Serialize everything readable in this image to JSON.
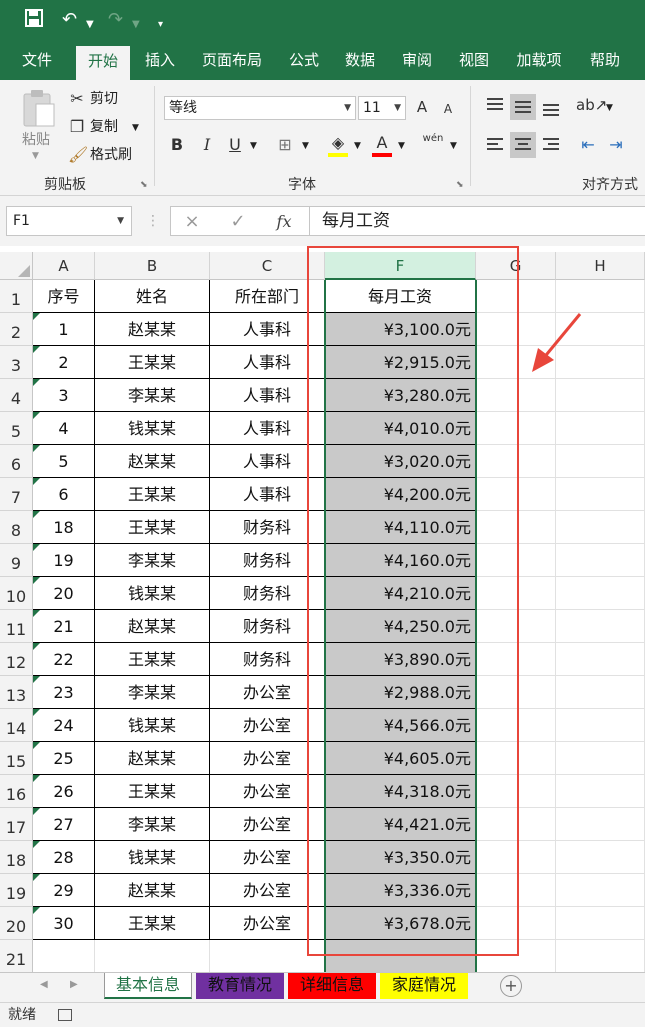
{
  "qat": {
    "save_icon": "save-icon",
    "undo_icon": "undo-icon",
    "redo_icon": "redo-icon",
    "customize_icon": "customize-qat-icon"
  },
  "tabs": [
    "文件",
    "开始",
    "插入",
    "页面布局",
    "公式",
    "数据",
    "审阅",
    "视图",
    "加载项",
    "帮助"
  ],
  "ribbon": {
    "clipboard": {
      "paste": "粘贴",
      "cut": "剪切",
      "copy": "复制",
      "format_painter": "格式刷",
      "label": "剪贴板"
    },
    "font": {
      "name": "等线",
      "size": "11",
      "bold": "B",
      "italic": "I",
      "underline": "U",
      "label": "字体",
      "grow": "A",
      "shrink": "A",
      "font_color": "A",
      "phonetic": "wén"
    },
    "alignment": {
      "label": "对齐方式"
    }
  },
  "formula_bar": {
    "name_box": "F1",
    "cancel": "×",
    "enter": "✓",
    "fx": "fx",
    "content": "每月工资"
  },
  "columns": [
    "A",
    "B",
    "C",
    "F",
    "G",
    "H"
  ],
  "rows": [
    {
      "n": "1",
      "a": "序号",
      "b": "姓名",
      "c": "所在部门",
      "f": "每月工资"
    },
    {
      "n": "2",
      "a": "1",
      "b": "赵某某",
      "c": "人事科",
      "f": "¥3,100.0元"
    },
    {
      "n": "3",
      "a": "2",
      "b": "王某某",
      "c": "人事科",
      "f": "¥2,915.0元"
    },
    {
      "n": "4",
      "a": "3",
      "b": "李某某",
      "c": "人事科",
      "f": "¥3,280.0元"
    },
    {
      "n": "5",
      "a": "4",
      "b": "钱某某",
      "c": "人事科",
      "f": "¥4,010.0元"
    },
    {
      "n": "6",
      "a": "5",
      "b": "赵某某",
      "c": "人事科",
      "f": "¥3,020.0元"
    },
    {
      "n": "7",
      "a": "6",
      "b": "王某某",
      "c": "人事科",
      "f": "¥4,200.0元"
    },
    {
      "n": "8",
      "a": "18",
      "b": "王某某",
      "c": "财务科",
      "f": "¥4,110.0元"
    },
    {
      "n": "9",
      "a": "19",
      "b": "李某某",
      "c": "财务科",
      "f": "¥4,160.0元"
    },
    {
      "n": "10",
      "a": "20",
      "b": "钱某某",
      "c": "财务科",
      "f": "¥4,210.0元"
    },
    {
      "n": "11",
      "a": "21",
      "b": "赵某某",
      "c": "财务科",
      "f": "¥4,250.0元"
    },
    {
      "n": "12",
      "a": "22",
      "b": "王某某",
      "c": "财务科",
      "f": "¥3,890.0元"
    },
    {
      "n": "13",
      "a": "23",
      "b": "李某某",
      "c": "办公室",
      "f": "¥2,988.0元"
    },
    {
      "n": "14",
      "a": "24",
      "b": "钱某某",
      "c": "办公室",
      "f": "¥4,566.0元"
    },
    {
      "n": "15",
      "a": "25",
      "b": "赵某某",
      "c": "办公室",
      "f": "¥4,605.0元"
    },
    {
      "n": "16",
      "a": "26",
      "b": "王某某",
      "c": "办公室",
      "f": "¥4,318.0元"
    },
    {
      "n": "17",
      "a": "27",
      "b": "李某某",
      "c": "办公室",
      "f": "¥4,421.0元"
    },
    {
      "n": "18",
      "a": "28",
      "b": "钱某某",
      "c": "办公室",
      "f": "¥3,350.0元"
    },
    {
      "n": "19",
      "a": "29",
      "b": "赵某某",
      "c": "办公室",
      "f": "¥3,336.0元"
    },
    {
      "n": "20",
      "a": "30",
      "b": "王某某",
      "c": "办公室",
      "f": "¥3,678.0元"
    },
    {
      "n": "21",
      "a": "",
      "b": "",
      "c": "",
      "f": ""
    }
  ],
  "sheets": [
    {
      "label": "基本信息",
      "color": "#ffffff"
    },
    {
      "label": "教育情况",
      "color": "#7030a0"
    },
    {
      "label": "详细信息",
      "color": "#ff0000"
    },
    {
      "label": "家庭情况",
      "color": "#ffff00"
    }
  ],
  "colors": {
    "brand": "#217346",
    "selection_fill": "#c9c9c9",
    "annotation": "#e8463b"
  },
  "status": {
    "text": "就绪"
  }
}
